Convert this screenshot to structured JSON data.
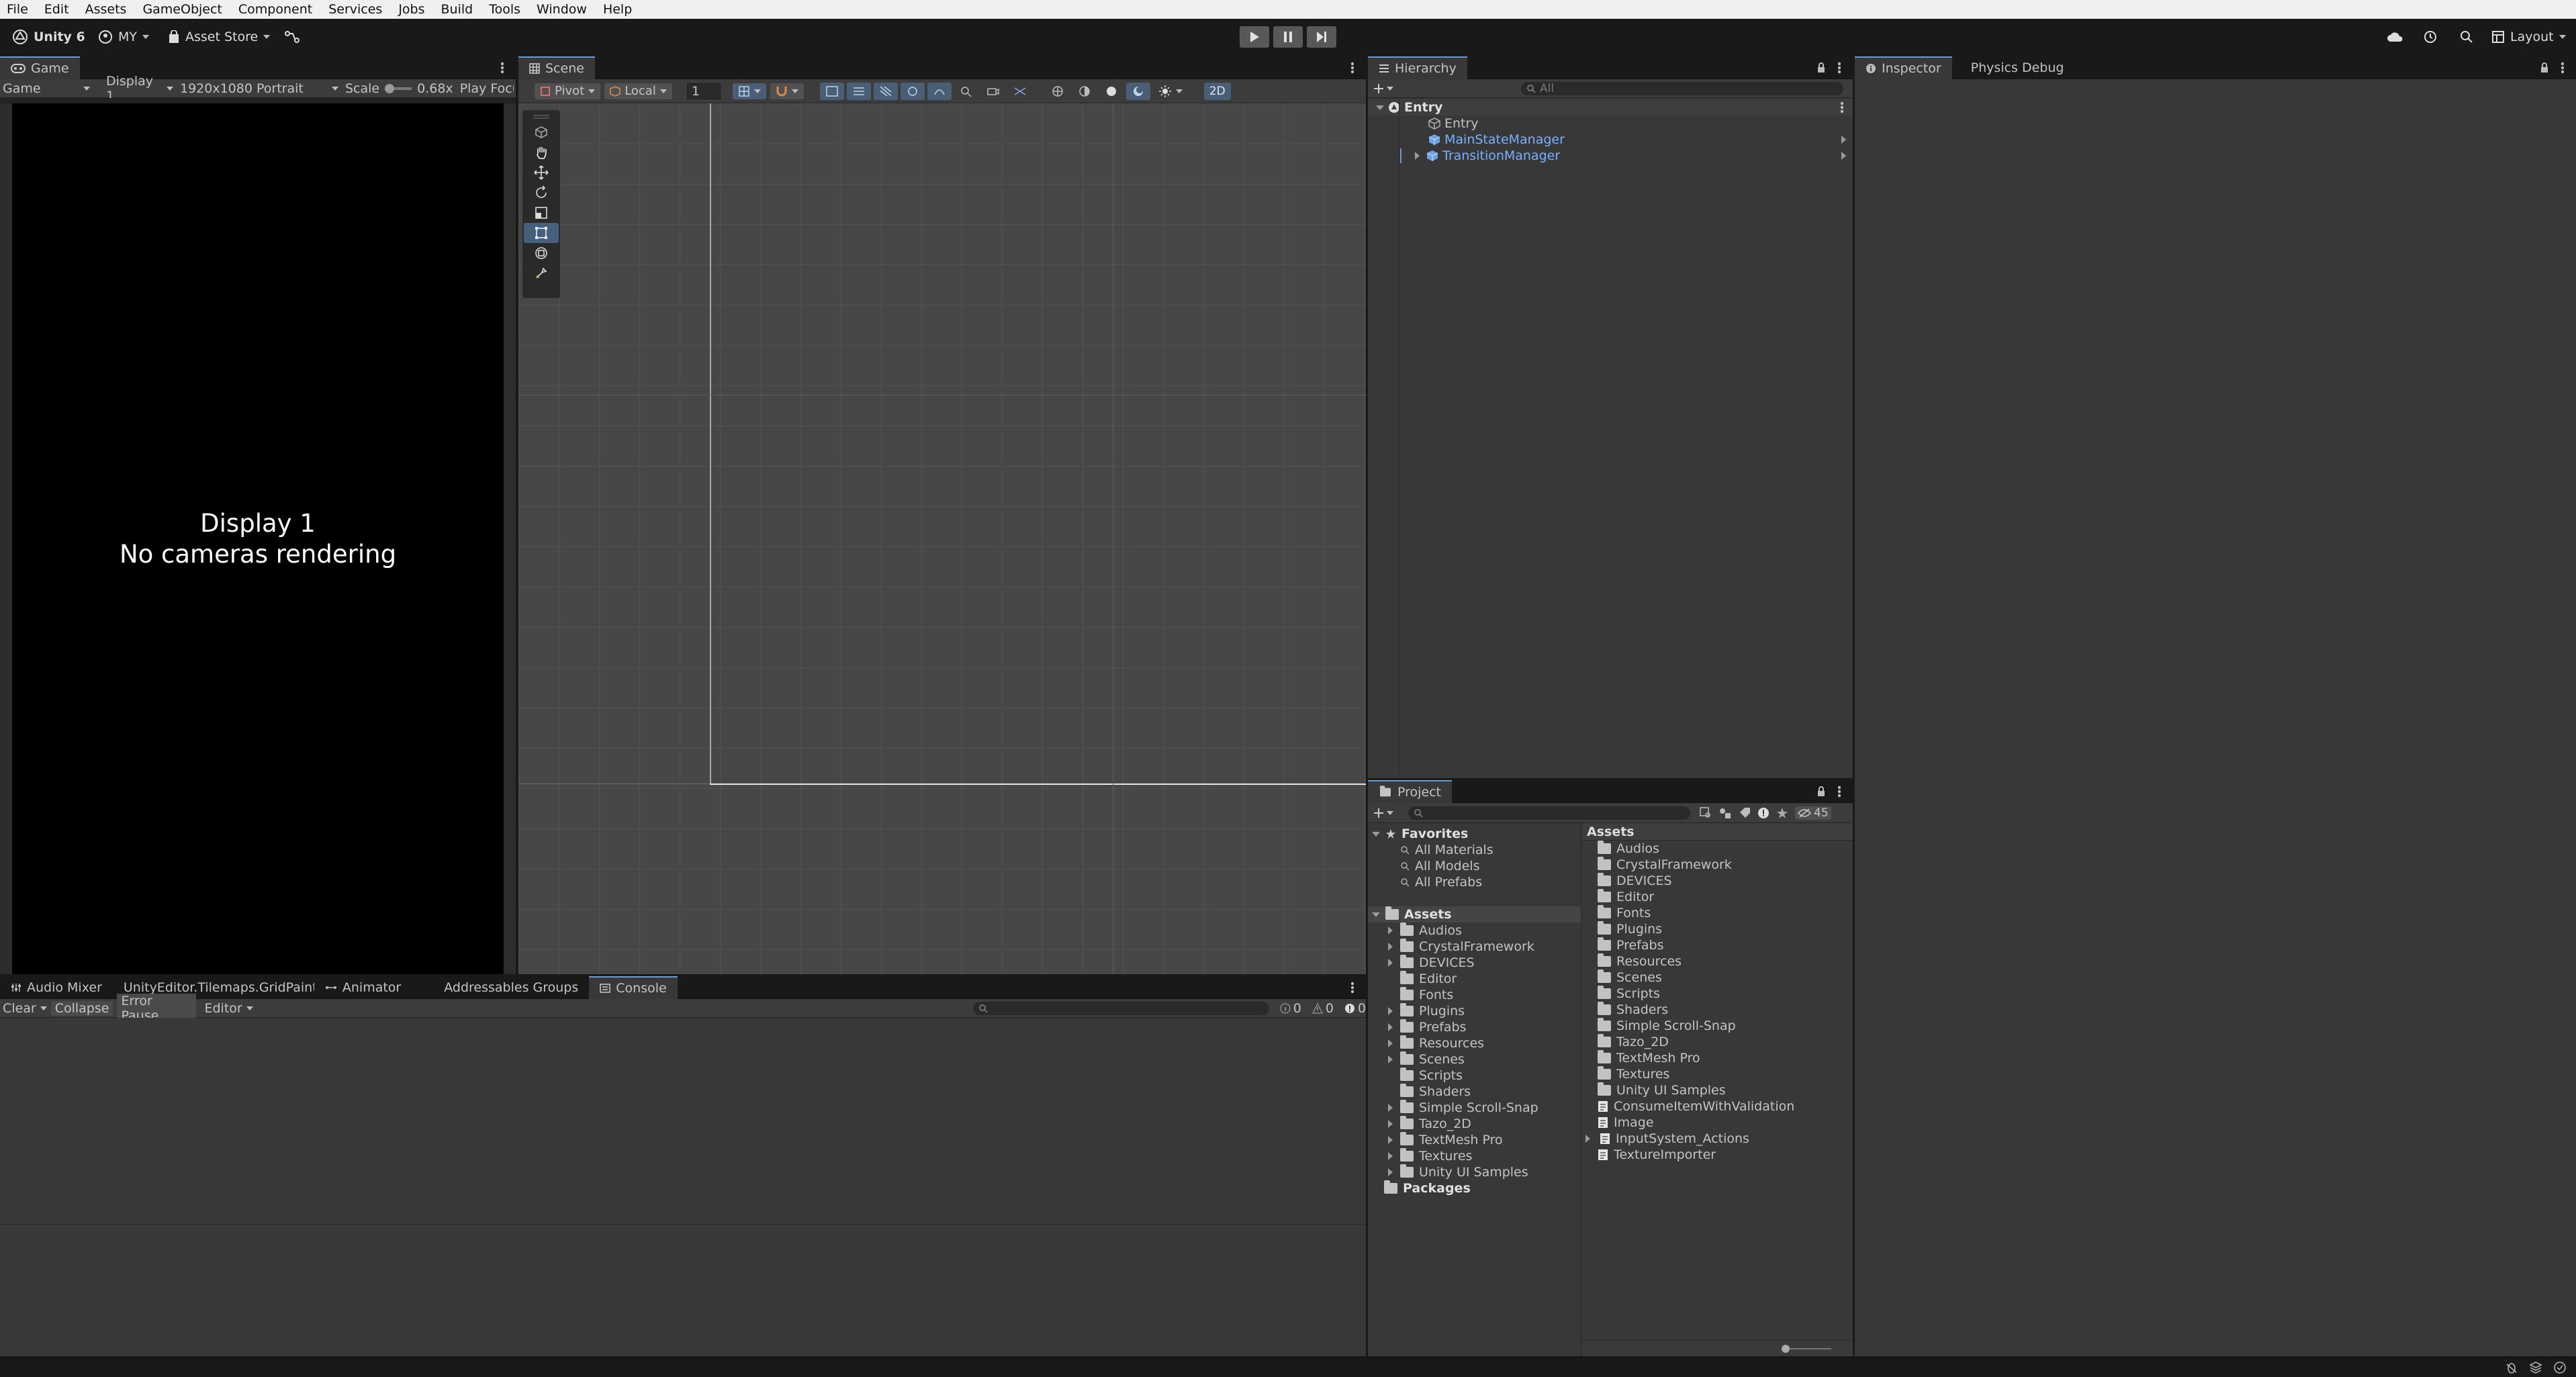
{
  "menu": [
    "File",
    "Edit",
    "Assets",
    "GameObject",
    "Component",
    "Services",
    "Jobs",
    "Build",
    "Tools",
    "Window",
    "Help"
  ],
  "toolbar": {
    "unity_label": "Unity 6",
    "account": "MY",
    "asset_store": "Asset Store",
    "layout": "Layout"
  },
  "game": {
    "tab": "Game",
    "mode": "Game",
    "display": "Display 1",
    "resolution": "1920x1080 Portrait",
    "scale_label": "Scale",
    "scale_value": "0.68x",
    "play_focus": "Play Focu",
    "message_line1": "Display 1",
    "message_line2": "No cameras rendering"
  },
  "scene": {
    "tab": "Scene",
    "pivot": "Pivot",
    "local": "Local",
    "snap_value": "1",
    "two_d": "2D"
  },
  "hierarchy": {
    "tab": "Hierarchy",
    "search_placeholder": "All",
    "scene_name": "Entry",
    "items": [
      {
        "label": "Entry",
        "color": "#c4c4c4"
      },
      {
        "label": "MainStateManager",
        "color": "#7ab0ff"
      },
      {
        "label": "TransitionManager",
        "color": "#7ab0ff"
      }
    ]
  },
  "inspector": {
    "tab": "Inspector",
    "tab2": "Physics Debug"
  },
  "project": {
    "tab": "Project",
    "count": "45",
    "favorites": {
      "title": "Favorites",
      "items": [
        "All Materials",
        "All Models",
        "All Prefabs"
      ]
    },
    "assets_title": "Assets",
    "tree": [
      "Audios",
      "CrystalFramework",
      "DEVICES",
      "Editor",
      "Fonts",
      "Plugins",
      "Prefabs",
      "Resources",
      "Scenes",
      "Scripts",
      "Shaders",
      "Simple Scroll-Snap",
      "Tazo_2D",
      "TextMesh Pro",
      "Textures",
      "Unity UI Samples"
    ],
    "packages": "Packages",
    "right_header": "Assets",
    "right_folders": [
      "Audios",
      "CrystalFramework",
      "DEVICES",
      "Editor",
      "Fonts",
      "Plugins",
      "Prefabs",
      "Resources",
      "Scenes",
      "Scripts",
      "Shaders",
      "Simple Scroll-Snap",
      "Tazo_2D",
      "TextMesh Pro",
      "Textures",
      "Unity UI Samples"
    ],
    "right_files": [
      "ConsumeItemWithValidation",
      "Image",
      "InputSystem_Actions",
      "TextureImporter"
    ]
  },
  "bottom_tabs": [
    "Audio Mixer",
    "UnityEditor.Tilemaps.GridPaintPæ",
    "Animator",
    "Addressables Groups",
    "Console"
  ],
  "console": {
    "clear": "Clear",
    "collapse": "Collapse",
    "error_pause": "Error Pause",
    "editor": "Editor",
    "count_info": "0",
    "count_warn": "0",
    "count_error": "0"
  },
  "colors": {
    "accent": "#6b9bd2",
    "blue_text": "#7ab0ff",
    "active_tool": "#46607c"
  }
}
